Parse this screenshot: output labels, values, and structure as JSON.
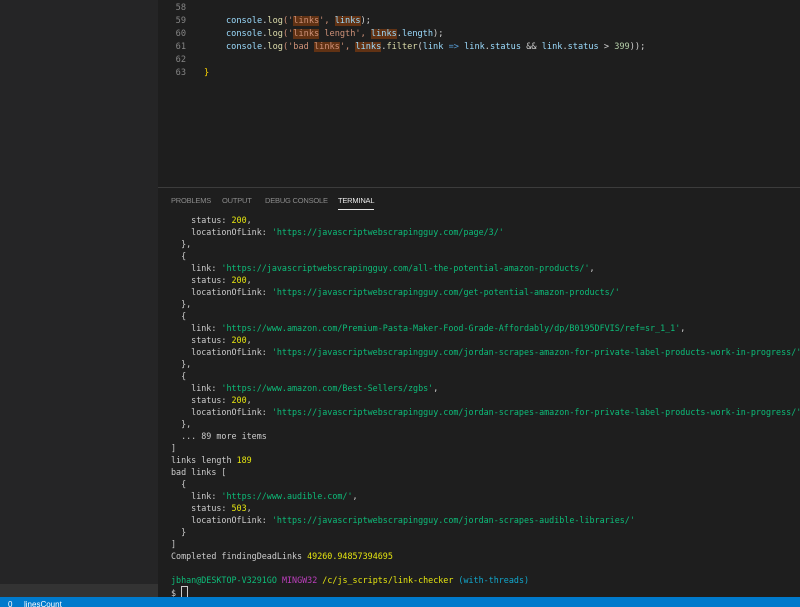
{
  "editor": {
    "lines": [
      {
        "num": "58",
        "tokens": []
      },
      {
        "num": "59",
        "tokens": [
          {
            "t": "console",
            "c": "k-var"
          },
          {
            "t": ".",
            "c": "k-plain"
          },
          {
            "t": "log",
            "c": "k-fn"
          },
          {
            "t": "('",
            "c": "k-str"
          },
          {
            "t": "links",
            "c": "k-str hl"
          },
          {
            "t": "', ",
            "c": "k-str"
          },
          {
            "t": "links",
            "c": "k-var hl"
          },
          {
            "t": ");",
            "c": "k-plain"
          }
        ]
      },
      {
        "num": "60",
        "tokens": [
          {
            "t": "console",
            "c": "k-var"
          },
          {
            "t": ".",
            "c": "k-plain"
          },
          {
            "t": "log",
            "c": "k-fn"
          },
          {
            "t": "('",
            "c": "k-str"
          },
          {
            "t": "links",
            "c": "k-str hl"
          },
          {
            "t": " length', ",
            "c": "k-str"
          },
          {
            "t": "links",
            "c": "k-var hl"
          },
          {
            "t": ".",
            "c": "k-plain"
          },
          {
            "t": "length",
            "c": "k-var"
          },
          {
            "t": ");",
            "c": "k-plain"
          }
        ]
      },
      {
        "num": "61",
        "tokens": [
          {
            "t": "console",
            "c": "k-var"
          },
          {
            "t": ".",
            "c": "k-plain"
          },
          {
            "t": "log",
            "c": "k-fn"
          },
          {
            "t": "('bad ",
            "c": "k-str"
          },
          {
            "t": "links",
            "c": "k-str hl"
          },
          {
            "t": "', ",
            "c": "k-str"
          },
          {
            "t": "links",
            "c": "k-var hl"
          },
          {
            "t": ".",
            "c": "k-plain"
          },
          {
            "t": "filter",
            "c": "k-fn"
          },
          {
            "t": "(",
            "c": "k-plain"
          },
          {
            "t": "link",
            "c": "k-var"
          },
          {
            "t": " => ",
            "c": "k-kw"
          },
          {
            "t": "link",
            "c": "k-var"
          },
          {
            "t": ".",
            "c": "k-plain"
          },
          {
            "t": "status",
            "c": "k-var"
          },
          {
            "t": " && ",
            "c": "k-plain"
          },
          {
            "t": "link",
            "c": "k-var"
          },
          {
            "t": ".",
            "c": "k-plain"
          },
          {
            "t": "status",
            "c": "k-var"
          },
          {
            "t": " > ",
            "c": "k-plain"
          },
          {
            "t": "399",
            "c": "k-num"
          },
          {
            "t": "));",
            "c": "k-plain"
          }
        ]
      },
      {
        "num": "62",
        "tokens": []
      },
      {
        "num": "63",
        "tokens": [
          {
            "t": "}",
            "c": "k-brace"
          }
        ]
      }
    ]
  },
  "panel": {
    "tabs": [
      {
        "label": "PROBLEMS",
        "active": false
      },
      {
        "label": "OUTPUT",
        "active": false
      },
      {
        "label": "DEBUG CONSOLE",
        "active": false
      },
      {
        "label": "TERMINAL",
        "active": true
      }
    ]
  },
  "terminal": {
    "lines": [
      [
        {
          "t": "    status: ",
          "c": "t-key"
        },
        {
          "t": "200",
          "c": "t-num"
        },
        {
          "t": ",",
          "c": "t-key"
        }
      ],
      [
        {
          "t": "    locationOfLink: ",
          "c": "t-key"
        },
        {
          "t": "'https://javascriptwebscrapingguy.com/page/3/'",
          "c": "t-str"
        }
      ],
      [
        {
          "t": "  },",
          "c": "t-key"
        }
      ],
      [
        {
          "t": "  {",
          "c": "t-key"
        }
      ],
      [
        {
          "t": "    link: ",
          "c": "t-key"
        },
        {
          "t": "'https://javascriptwebscrapingguy.com/all-the-potential-amazon-products/'",
          "c": "t-str"
        },
        {
          "t": ",",
          "c": "t-key"
        }
      ],
      [
        {
          "t": "    status: ",
          "c": "t-key"
        },
        {
          "t": "200",
          "c": "t-num"
        },
        {
          "t": ",",
          "c": "t-key"
        }
      ],
      [
        {
          "t": "    locationOfLink: ",
          "c": "t-key"
        },
        {
          "t": "'https://javascriptwebscrapingguy.com/get-potential-amazon-products/'",
          "c": "t-str"
        }
      ],
      [
        {
          "t": "  },",
          "c": "t-key"
        }
      ],
      [
        {
          "t": "  {",
          "c": "t-key"
        }
      ],
      [
        {
          "t": "    link: ",
          "c": "t-key"
        },
        {
          "t": "'https://www.amazon.com/Premium-Pasta-Maker-Food-Grade-Affordably/dp/B0195DFVIS/ref=sr_1_1'",
          "c": "t-str"
        },
        {
          "t": ",",
          "c": "t-key"
        }
      ],
      [
        {
          "t": "    status: ",
          "c": "t-key"
        },
        {
          "t": "200",
          "c": "t-num"
        },
        {
          "t": ",",
          "c": "t-key"
        }
      ],
      [
        {
          "t": "    locationOfLink: ",
          "c": "t-key"
        },
        {
          "t": "'https://javascriptwebscrapingguy.com/jordan-scrapes-amazon-for-private-label-products-work-in-progress/'",
          "c": "t-str"
        }
      ],
      [
        {
          "t": "  },",
          "c": "t-key"
        }
      ],
      [
        {
          "t": "  {",
          "c": "t-key"
        }
      ],
      [
        {
          "t": "    link: ",
          "c": "t-key"
        },
        {
          "t": "'https://www.amazon.com/Best-Sellers/zgbs'",
          "c": "t-str"
        },
        {
          "t": ",",
          "c": "t-key"
        }
      ],
      [
        {
          "t": "    status: ",
          "c": "t-key"
        },
        {
          "t": "200",
          "c": "t-num"
        },
        {
          "t": ",",
          "c": "t-key"
        }
      ],
      [
        {
          "t": "    locationOfLink: ",
          "c": "t-key"
        },
        {
          "t": "'https://javascriptwebscrapingguy.com/jordan-scrapes-amazon-for-private-label-products-work-in-progress/'",
          "c": "t-str"
        }
      ],
      [
        {
          "t": "  },",
          "c": "t-key"
        }
      ],
      [
        {
          "t": "  ... 89 more items",
          "c": "t-key"
        }
      ],
      [
        {
          "t": "]",
          "c": "t-key"
        }
      ],
      [
        {
          "t": "links length ",
          "c": "t-key"
        },
        {
          "t": "189",
          "c": "t-num"
        }
      ],
      [
        {
          "t": "bad links [",
          "c": "t-key"
        }
      ],
      [
        {
          "t": "  {",
          "c": "t-key"
        }
      ],
      [
        {
          "t": "    link: ",
          "c": "t-key"
        },
        {
          "t": "'https://www.audible.com/'",
          "c": "t-str"
        },
        {
          "t": ",",
          "c": "t-key"
        }
      ],
      [
        {
          "t": "    status: ",
          "c": "t-key"
        },
        {
          "t": "503",
          "c": "t-num"
        },
        {
          "t": ",",
          "c": "t-key"
        }
      ],
      [
        {
          "t": "    locationOfLink: ",
          "c": "t-key"
        },
        {
          "t": "'https://javascriptwebscrapingguy.com/jordan-scrapes-audible-libraries/'",
          "c": "t-str"
        }
      ],
      [
        {
          "t": "  }",
          "c": "t-key"
        }
      ],
      [
        {
          "t": "]",
          "c": "t-key"
        }
      ],
      [
        {
          "t": "Completed findingDeadLinks ",
          "c": "t-key"
        },
        {
          "t": "49260.94857394695",
          "c": "t-num"
        }
      ],
      [],
      [
        {
          "t": "jbhan@DESKTOP-V3291GO ",
          "c": "t-green"
        },
        {
          "t": "MINGW32 ",
          "c": "t-magenta"
        },
        {
          "t": "/c/js_scripts/link-checker",
          "c": "t-yellow"
        },
        {
          "t": " (with-threads)",
          "c": "t-cyan"
        }
      ],
      [
        {
          "t": "$ ",
          "c": "t-key"
        },
        {
          "t": "",
          "c": "cursor"
        }
      ]
    ]
  },
  "status_bar": {
    "items": [
      "0",
      "linesCount"
    ]
  }
}
